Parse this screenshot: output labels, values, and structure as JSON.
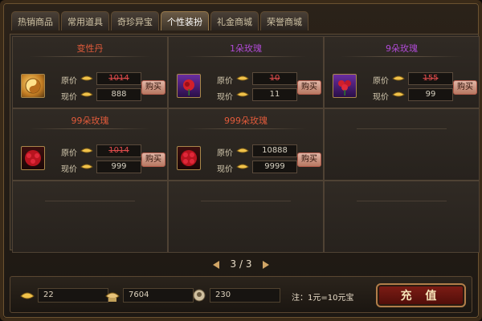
{
  "tabs": [
    {
      "label": "热销商品",
      "active": false
    },
    {
      "label": "常用道具",
      "active": false
    },
    {
      "label": "奇珍异宝",
      "active": false
    },
    {
      "label": "个性装扮",
      "active": true
    },
    {
      "label": "礼金商城",
      "active": false
    },
    {
      "label": "荣誉商城",
      "active": false
    }
  ],
  "labels": {
    "original": "原价",
    "current": "现价",
    "buy": "购买"
  },
  "items": [
    {
      "name": "变性丹",
      "name_color": "#e25b3b",
      "icon": "yin-yang-pill-icon",
      "original_price": "1014",
      "current_price": "888"
    },
    {
      "name": "1朵玫瑰",
      "name_color": "#b04ad6",
      "icon": "single-rose-icon",
      "original_price": "10",
      "current_price": "11"
    },
    {
      "name": "9朵玫瑰",
      "name_color": "#b04ad6",
      "icon": "nine-roses-icon",
      "original_price": "155",
      "current_price": "99"
    },
    {
      "name": "99朵玫瑰",
      "name_color": "#e25b3b",
      "icon": "ninety-nine-roses-icon",
      "original_price": "1014",
      "current_price": "999"
    },
    {
      "name": "999朵玫瑰",
      "name_color": "#e25b3b",
      "icon": "nine-hundred-ninety-nine-roses-icon",
      "original_price": "10888",
      "current_price": "9999"
    }
  ],
  "pager": {
    "text": "3 / 3"
  },
  "currency": [
    {
      "icon": "gold-ingot-icon",
      "value": "22"
    },
    {
      "icon": "gift-ingot-icon",
      "value": "7604"
    },
    {
      "icon": "honor-icon",
      "value": "230"
    }
  ],
  "note": "注：1元=10元宝",
  "recharge_label": "充 值"
}
